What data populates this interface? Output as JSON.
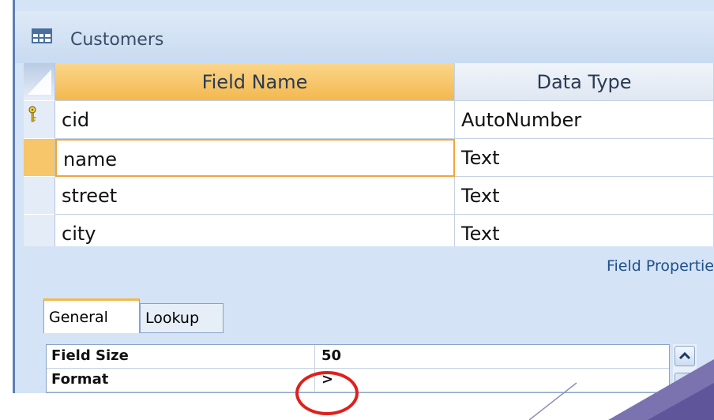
{
  "window": {
    "title": "Customers"
  },
  "grid": {
    "headers": {
      "field_name": "Field Name",
      "data_type": "Data Type"
    },
    "rows": [
      {
        "field_name": "cid",
        "data_type": "AutoNumber",
        "primary_key": true
      },
      {
        "field_name": "name",
        "data_type": "Text",
        "active": true
      },
      {
        "field_name": "street",
        "data_type": "Text"
      },
      {
        "field_name": "city",
        "data_type": "Text"
      }
    ]
  },
  "properties": {
    "title": "Field Propertie",
    "tabs": [
      {
        "label": "General",
        "selected": true
      },
      {
        "label": "Lookup",
        "selected": false
      }
    ],
    "rows": [
      {
        "label": "Field Size",
        "value": "50"
      },
      {
        "label": "Format",
        "value": ">"
      }
    ]
  },
  "icons": {
    "table": "table-icon",
    "key": "primary-key-icon",
    "scroll_up": "chevron-up-icon"
  },
  "colors": {
    "active_header": "#f3b84f",
    "panel_background": "#d4e3f5",
    "highlight": "#e0201b",
    "properties_title": "#20508c"
  }
}
